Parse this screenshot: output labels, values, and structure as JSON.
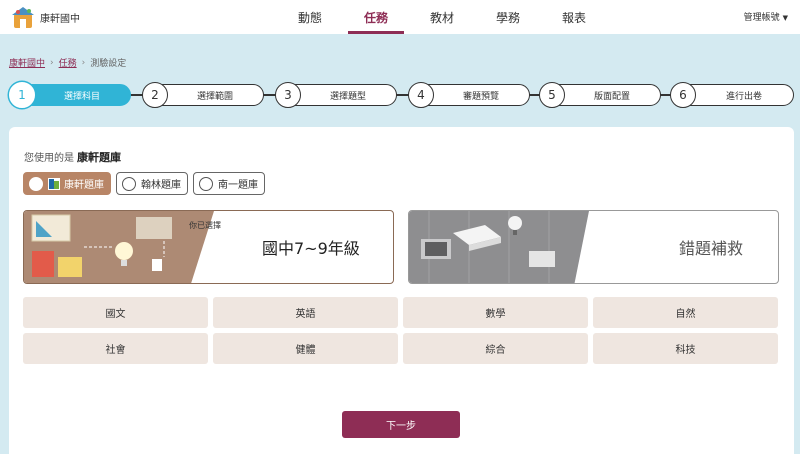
{
  "header": {
    "school_name": "康軒國中",
    "nav": [
      "動態",
      "任務",
      "教材",
      "學務",
      "報表"
    ],
    "active_nav": "任務",
    "account_label": "管理帳號"
  },
  "breadcrumb": {
    "items": [
      "康軒國中",
      "任務",
      "測驗設定"
    ]
  },
  "steps": [
    {
      "num": "1",
      "label": "選擇科目",
      "active": true
    },
    {
      "num": "2",
      "label": "選擇範圍",
      "active": false
    },
    {
      "num": "3",
      "label": "選擇題型",
      "active": false
    },
    {
      "num": "4",
      "label": "審題預覽",
      "active": false
    },
    {
      "num": "5",
      "label": "版面配置",
      "active": false
    },
    {
      "num": "6",
      "label": "進行出卷",
      "active": false
    }
  ],
  "source": {
    "prefix": "您使用的是",
    "current": "康軒題庫",
    "options": [
      "康軒題庫",
      "翰林題庫",
      "南一題庫"
    ],
    "selected": "康軒題庫"
  },
  "banners": {
    "grade": {
      "chosen_label": "你已選擇",
      "title": "國中7~9年級"
    },
    "review": {
      "title": "錯題補救"
    }
  },
  "subjects": [
    "國文",
    "英語",
    "數學",
    "自然",
    "社會",
    "健體",
    "綜合",
    "科技"
  ],
  "actions": {
    "next_label": "下一步"
  },
  "colors": {
    "accent": "#8e2d55",
    "step_active": "#30b4d6",
    "selected_source": "#b88566"
  }
}
